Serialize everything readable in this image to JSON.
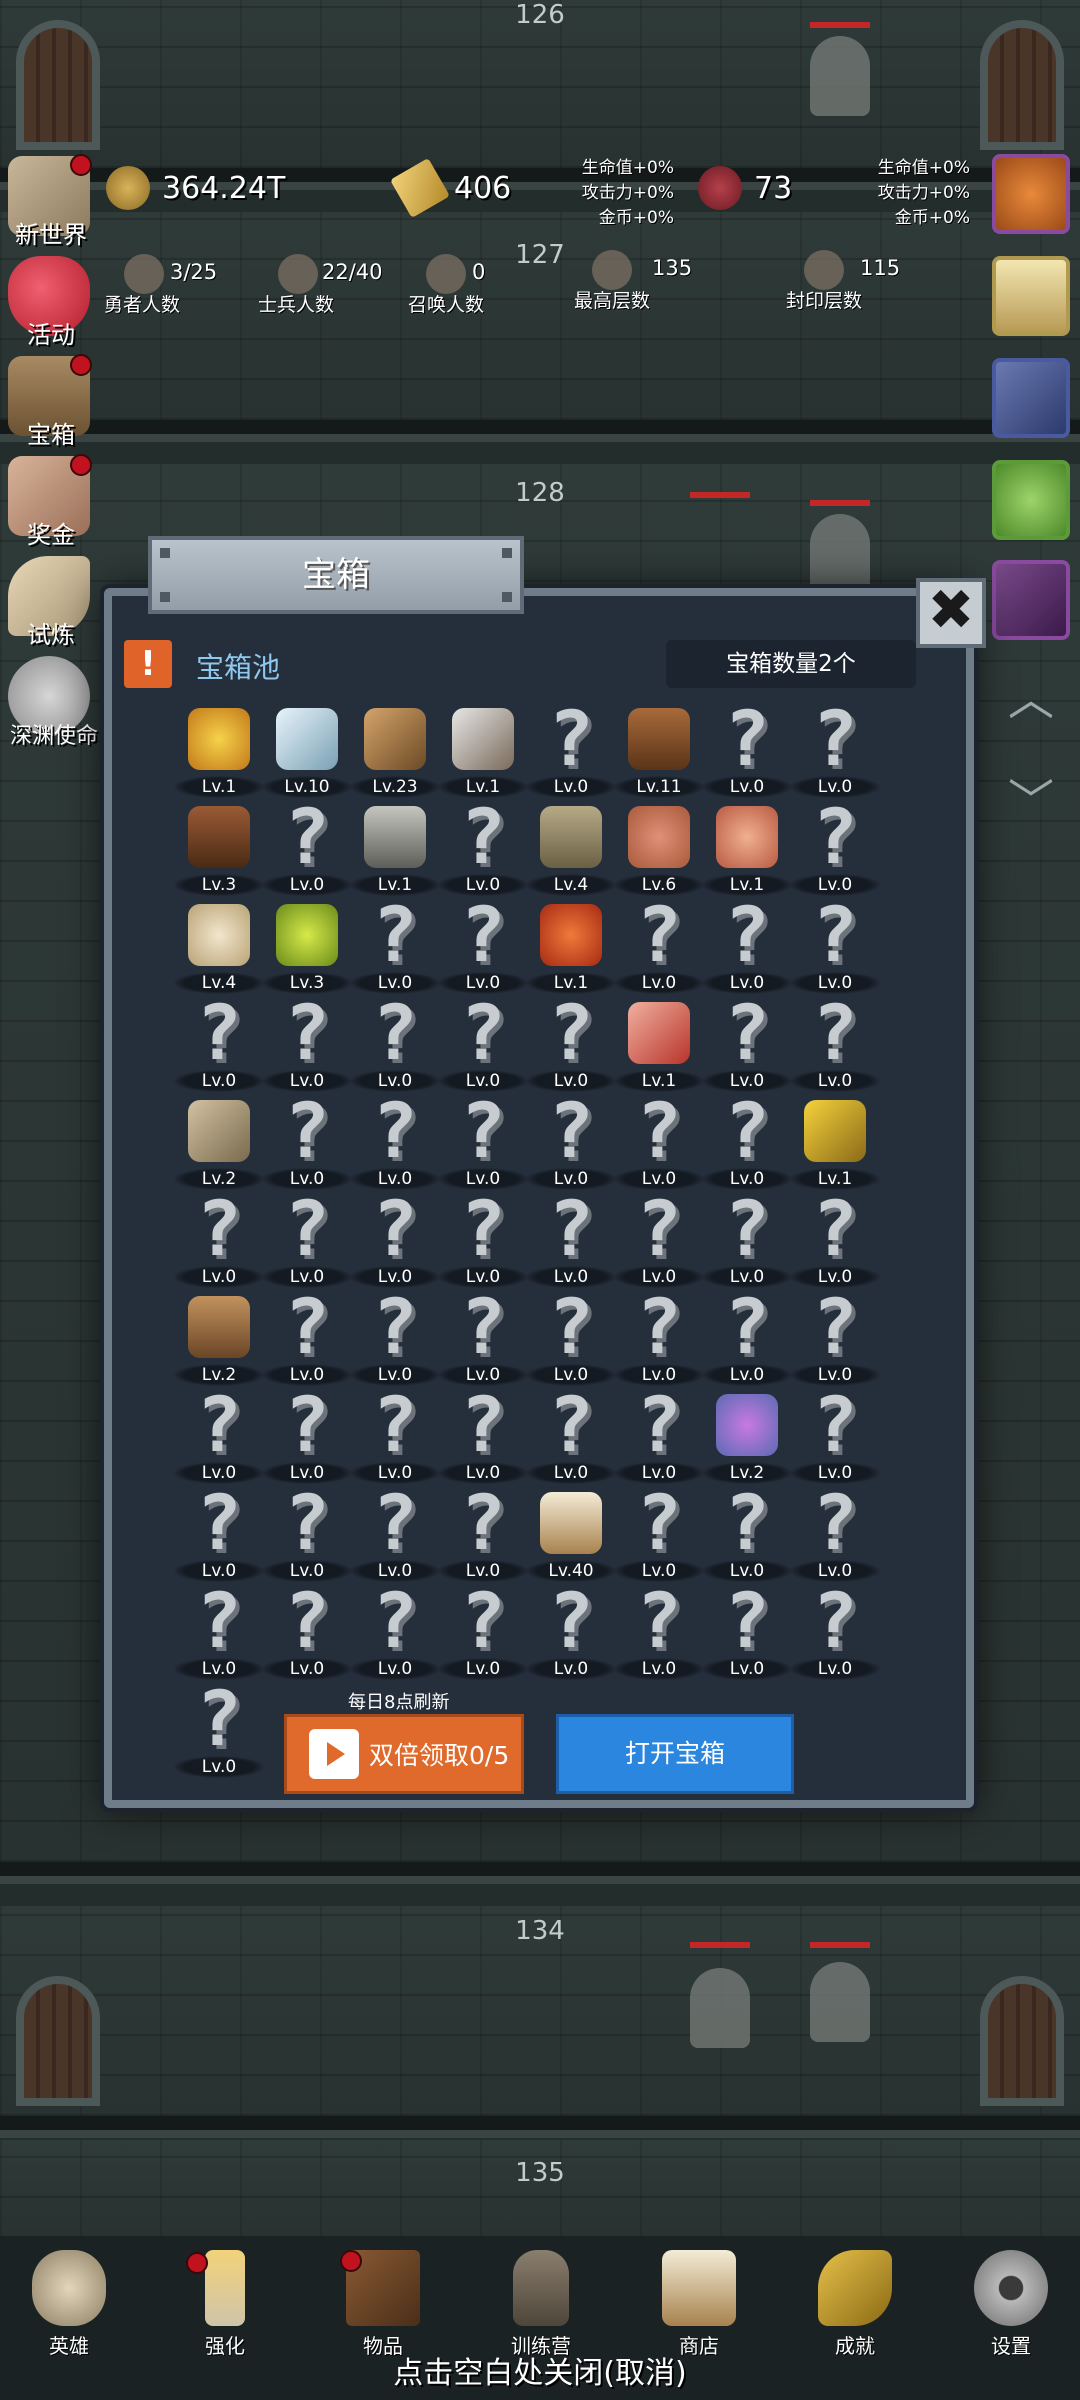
{
  "floors": [
    "126",
    "127",
    "128",
    "134",
    "135"
  ],
  "hud": {
    "gold": "364.24T",
    "bars": "406",
    "meat": "73",
    "bonus_left": [
      "生命值+0%",
      "攻击力+0%",
      "金币+0%"
    ],
    "bonus_right": [
      "生命值+0%",
      "攻击力+0%",
      "金币+0%"
    ],
    "stats": [
      {
        "value": "3/25",
        "label": "勇者人数"
      },
      {
        "value": "22/40",
        "label": "士兵人数"
      },
      {
        "value": "0",
        "label": "召唤人数"
      },
      {
        "value": "135",
        "label": "最高层数"
      },
      {
        "value": "115",
        "label": "封印层数"
      }
    ]
  },
  "side_menu": [
    "新世界",
    "活动",
    "宝箱",
    "奖金",
    "试炼",
    "深渊使命"
  ],
  "modal": {
    "title": "宝箱",
    "pool_title": "宝箱池",
    "pool_icon": "!",
    "count_label": "宝箱数量2个",
    "close": "✖",
    "refresh_note": "每日8点刷新",
    "double_button": "双倍领取0/5",
    "open_button": "打开宝箱"
  },
  "grid": [
    [
      {
        "i": "crown",
        "lv": "Lv.1"
      },
      {
        "i": "diamond",
        "lv": "Lv.10"
      },
      {
        "i": "sword-bronze",
        "lv": "Lv.23"
      },
      {
        "i": "sword-iron",
        "lv": "Lv.1"
      },
      {
        "i": "unknown",
        "lv": "Lv.0"
      },
      {
        "i": "leather-armor",
        "lv": "Lv.11"
      },
      {
        "i": "unknown",
        "lv": "Lv.0"
      },
      {
        "i": "unknown",
        "lv": "Lv.0"
      }
    ],
    [
      {
        "i": "leather-helm",
        "lv": "Lv.3"
      },
      {
        "i": "unknown",
        "lv": "Lv.0"
      },
      {
        "i": "knight-helm",
        "lv": "Lv.1"
      },
      {
        "i": "unknown",
        "lv": "Lv.0"
      },
      {
        "i": "great-helm",
        "lv": "Lv.4"
      },
      {
        "i": "ham",
        "lv": "Lv.6"
      },
      {
        "i": "steak",
        "lv": "Lv.1"
      },
      {
        "i": "unknown",
        "lv": "Lv.0"
      }
    ],
    [
      {
        "i": "bread",
        "lv": "Lv.4"
      },
      {
        "i": "green-potion",
        "lv": "Lv.3"
      },
      {
        "i": "unknown",
        "lv": "Lv.0"
      },
      {
        "i": "unknown",
        "lv": "Lv.0"
      },
      {
        "i": "red-potion",
        "lv": "Lv.1"
      },
      {
        "i": "unknown",
        "lv": "Lv.0"
      },
      {
        "i": "unknown",
        "lv": "Lv.0"
      },
      {
        "i": "unknown",
        "lv": "Lv.0"
      }
    ],
    [
      {
        "i": "unknown",
        "lv": "Lv.0"
      },
      {
        "i": "unknown",
        "lv": "Lv.0"
      },
      {
        "i": "unknown",
        "lv": "Lv.0"
      },
      {
        "i": "unknown",
        "lv": "Lv.0"
      },
      {
        "i": "unknown",
        "lv": "Lv.0"
      },
      {
        "i": "red-flask",
        "lv": "Lv.1"
      },
      {
        "i": "unknown",
        "lv": "Lv.0"
      },
      {
        "i": "unknown",
        "lv": "Lv.0"
      }
    ],
    [
      {
        "i": "boot",
        "lv": "Lv.2"
      },
      {
        "i": "unknown",
        "lv": "Lv.0"
      },
      {
        "i": "unknown",
        "lv": "Lv.0"
      },
      {
        "i": "unknown",
        "lv": "Lv.0"
      },
      {
        "i": "unknown",
        "lv": "Lv.0"
      },
      {
        "i": "unknown",
        "lv": "Lv.0"
      },
      {
        "i": "unknown",
        "lv": "Lv.0"
      },
      {
        "i": "torch",
        "lv": "Lv.1"
      }
    ],
    [
      {
        "i": "unknown",
        "lv": "Lv.0"
      },
      {
        "i": "unknown",
        "lv": "Lv.0"
      },
      {
        "i": "unknown",
        "lv": "Lv.0"
      },
      {
        "i": "unknown",
        "lv": "Lv.0"
      },
      {
        "i": "unknown",
        "lv": "Lv.0"
      },
      {
        "i": "unknown",
        "lv": "Lv.0"
      },
      {
        "i": "unknown",
        "lv": "Lv.0"
      },
      {
        "i": "unknown",
        "lv": "Lv.0"
      }
    ],
    [
      {
        "i": "backpack",
        "lv": "Lv.2"
      },
      {
        "i": "unknown",
        "lv": "Lv.0"
      },
      {
        "i": "unknown",
        "lv": "Lv.0"
      },
      {
        "i": "unknown",
        "lv": "Lv.0"
      },
      {
        "i": "unknown",
        "lv": "Lv.0"
      },
      {
        "i": "unknown",
        "lv": "Lv.0"
      },
      {
        "i": "unknown",
        "lv": "Lv.0"
      },
      {
        "i": "unknown",
        "lv": "Lv.0"
      }
    ],
    [
      {
        "i": "unknown",
        "lv": "Lv.0"
      },
      {
        "i": "unknown",
        "lv": "Lv.0"
      },
      {
        "i": "unknown",
        "lv": "Lv.0"
      },
      {
        "i": "unknown",
        "lv": "Lv.0"
      },
      {
        "i": "unknown",
        "lv": "Lv.0"
      },
      {
        "i": "unknown",
        "lv": "Lv.0"
      },
      {
        "i": "eye-monster",
        "lv": "Lv.2"
      },
      {
        "i": "unknown",
        "lv": "Lv.0"
      }
    ],
    [
      {
        "i": "unknown",
        "lv": "Lv.0"
      },
      {
        "i": "unknown",
        "lv": "Lv.0"
      },
      {
        "i": "unknown",
        "lv": "Lv.0"
      },
      {
        "i": "unknown",
        "lv": "Lv.0"
      },
      {
        "i": "beer-mug",
        "lv": "Lv.40"
      },
      {
        "i": "unknown",
        "lv": "Lv.0"
      },
      {
        "i": "unknown",
        "lv": "Lv.0"
      },
      {
        "i": "unknown",
        "lv": "Lv.0"
      }
    ],
    [
      {
        "i": "unknown",
        "lv": "Lv.0"
      },
      {
        "i": "unknown",
        "lv": "Lv.0"
      },
      {
        "i": "unknown",
        "lv": "Lv.0"
      },
      {
        "i": "unknown",
        "lv": "Lv.0"
      },
      {
        "i": "unknown",
        "lv": "Lv.0"
      },
      {
        "i": "unknown",
        "lv": "Lv.0"
      },
      {
        "i": "unknown",
        "lv": "Lv.0"
      },
      {
        "i": "unknown",
        "lv": "Lv.0"
      }
    ],
    [
      {
        "i": "unknown",
        "lv": "Lv.0"
      }
    ]
  ],
  "unknown_glyph": "?",
  "bottom_nav": [
    "英雄",
    "强化",
    "物品",
    "训练营",
    "商店",
    "成就",
    "设置"
  ],
  "close_hint": "点击空白处关闭(取消)"
}
